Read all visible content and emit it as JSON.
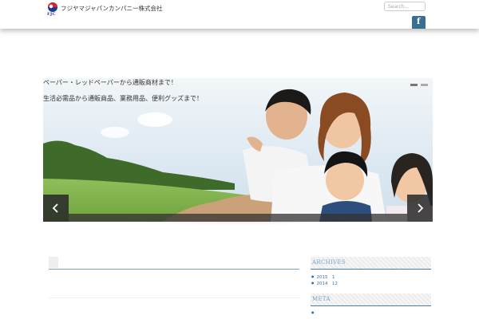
{
  "header": {
    "logo_text": "FJC",
    "company_name": "フジヤマジャパンカンパニー株式会社",
    "search_placeholder": "Search...",
    "social_icon": "facebook-icon",
    "social_glyph": "f"
  },
  "slider": {
    "caption_line_1": "ペーパー・レッドペーパーから通販商材まで！",
    "caption_line_2": "生活必需品から通販商品、業務用品、便利グッズまで！",
    "prev_icon": "chevron-left-icon",
    "next_icon": "chevron-right-icon"
  },
  "sidebar": {
    "archives_title": "ARCHIVES",
    "archives": [
      "2015　1",
      "2014　12"
    ],
    "meta_title": "META",
    "meta_items": [
      ""
    ]
  },
  "colors": {
    "accent": "#4a7da8",
    "link": "#3b6fa5",
    "facebook": "#3a6f8f"
  }
}
